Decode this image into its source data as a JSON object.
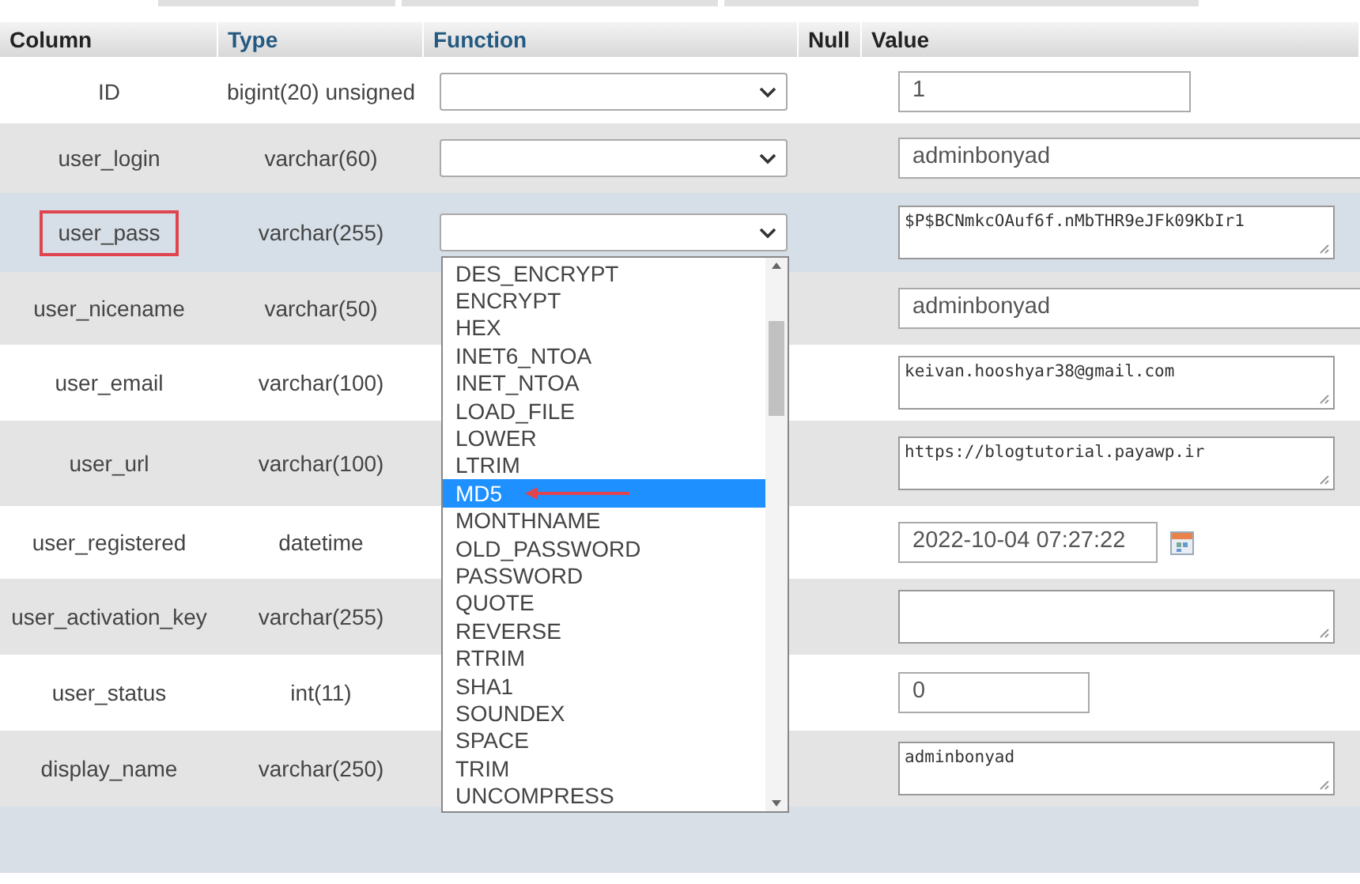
{
  "headers": [
    {
      "label": "Column",
      "link": false
    },
    {
      "label": "Type",
      "link": true
    },
    {
      "label": "Function",
      "link": true
    },
    {
      "label": "Null",
      "link": false
    },
    {
      "label": "Value",
      "link": false
    }
  ],
  "rows": [
    {
      "column": "ID",
      "type": "bigint(20) unsigned",
      "has_function": true,
      "highlighted": false,
      "outlined": false,
      "value": {
        "kind": "input",
        "text": "1"
      }
    },
    {
      "column": "user_login",
      "type": "varchar(60)",
      "has_function": true,
      "highlighted": false,
      "outlined": false,
      "value": {
        "kind": "input",
        "text": "adminbonyad"
      }
    },
    {
      "column": "user_pass",
      "type": "varchar(255)",
      "has_function": true,
      "highlighted": true,
      "outlined": true,
      "value": {
        "kind": "textarea",
        "text": "$P$BCNmkcOAuf6f.nMbTHR9eJFk09KbIr1"
      }
    },
    {
      "column": "user_nicename",
      "type": "varchar(50)",
      "has_function": false,
      "highlighted": false,
      "outlined": false,
      "value": {
        "kind": "input",
        "text": "adminbonyad"
      }
    },
    {
      "column": "user_email",
      "type": "varchar(100)",
      "has_function": false,
      "highlighted": false,
      "outlined": false,
      "value": {
        "kind": "textarea",
        "text": "keivan.hooshyar38@gmail.com"
      }
    },
    {
      "column": "user_url",
      "type": "varchar(100)",
      "has_function": false,
      "highlighted": false,
      "outlined": false,
      "value": {
        "kind": "textarea",
        "text": "https://blogtutorial.payawp.ir"
      }
    },
    {
      "column": "user_registered",
      "type": "datetime",
      "has_function": false,
      "highlighted": false,
      "outlined": false,
      "value": {
        "kind": "datetime",
        "text": "2022-10-04 07:27:22"
      }
    },
    {
      "column": "user_activation_key",
      "type": "varchar(255)",
      "has_function": false,
      "highlighted": false,
      "outlined": false,
      "value": {
        "kind": "textarea"
      }
    },
    {
      "column": "user_status",
      "type": "int(11)",
      "has_function": false,
      "highlighted": false,
      "outlined": false,
      "value": {
        "kind": "input",
        "text": "0"
      }
    },
    {
      "column": "display_name",
      "type": "varchar(250)",
      "has_function": false,
      "highlighted": false,
      "outlined": false,
      "value": {
        "kind": "textarea",
        "text": "adminbonyad"
      }
    }
  ],
  "dropdown": {
    "options": [
      {
        "label": "DES_ENCRYPT",
        "selected": false,
        "arrow": false
      },
      {
        "label": "ENCRYPT",
        "selected": false,
        "arrow": false
      },
      {
        "label": "HEX",
        "selected": false,
        "arrow": false
      },
      {
        "label": "INET6_NTOA",
        "selected": false,
        "arrow": false
      },
      {
        "label": "INET_NTOA",
        "selected": false,
        "arrow": false
      },
      {
        "label": "LOAD_FILE",
        "selected": false,
        "arrow": false
      },
      {
        "label": "LOWER",
        "selected": false,
        "arrow": false
      },
      {
        "label": "LTRIM",
        "selected": false,
        "arrow": false
      },
      {
        "label": "MD5",
        "selected": true,
        "arrow": true
      },
      {
        "label": "MONTHNAME",
        "selected": false,
        "arrow": false
      },
      {
        "label": "OLD_PASSWORD",
        "selected": false,
        "arrow": false
      },
      {
        "label": "PASSWORD",
        "selected": false,
        "arrow": false
      },
      {
        "label": "QUOTE",
        "selected": false,
        "arrow": false
      },
      {
        "label": "REVERSE",
        "selected": false,
        "arrow": false
      },
      {
        "label": "RTRIM",
        "selected": false,
        "arrow": false
      },
      {
        "label": "SHA1",
        "selected": false,
        "arrow": false
      },
      {
        "label": "SOUNDEX",
        "selected": false,
        "arrow": false
      },
      {
        "label": "SPACE",
        "selected": false,
        "arrow": false
      },
      {
        "label": "TRIM",
        "selected": false,
        "arrow": false
      },
      {
        "label": "UNCOMPRESS",
        "selected": false,
        "arrow": false
      }
    ]
  }
}
